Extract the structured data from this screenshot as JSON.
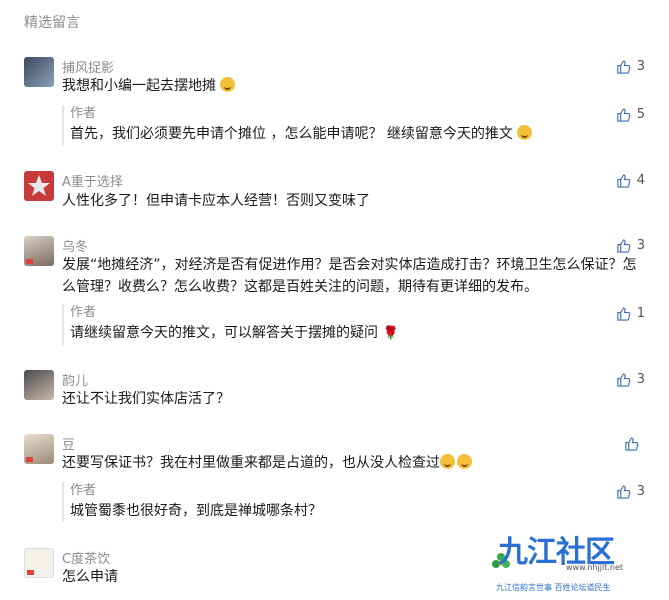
{
  "section_title": "精选留言",
  "comments": [
    {
      "nick": "捕风捉影",
      "text": "我想和小编一起去摆地摊",
      "likes": "3",
      "reply": {
        "nick": "作者",
        "text": "首先，我们必须要先申请个摊位 ，怎么能申请呢？ 继续留意今天的推文",
        "likes": "5"
      }
    },
    {
      "nick": "A重于选择",
      "text": "人性化多了！但申请卡应本人经营！否则又变味了",
      "likes": "4"
    },
    {
      "nick": "乌冬",
      "text": "发展“地摊经济”，对经济是否有促进作用？是否会对实体店造成打击？环境卫生怎么保证？怎么管理？收费么？怎么收费？这都是百姓关注的问题，期待有更详细的发布。",
      "likes": "3",
      "reply": {
        "nick": "作者",
        "text": "请继续留意今天的推文，可以解答关于摆摊的疑问",
        "likes": "1"
      }
    },
    {
      "nick": "韵儿",
      "text": "还让不让我们实体店活了？",
      "likes": "3"
    },
    {
      "nick": "豆",
      "text": "还要写保证书？我在村里做重来都是占道的，也从没人检查过",
      "likes": "",
      "reply": {
        "nick": "作者",
        "text": "城管蜀黍也很好奇，到底是禅城哪条村？",
        "likes": "3"
      }
    },
    {
      "nick": "C度茶饮",
      "text": "怎么申请",
      "likes": ""
    }
  ],
  "watermark": {
    "logo": "九江社区",
    "url": "www.nhjjlt.net",
    "slogan": "九江信韵言世事  百姓论坛道民生"
  },
  "colors": {
    "muted": "#8c8c8c",
    "brand": "#2a6fd4"
  }
}
